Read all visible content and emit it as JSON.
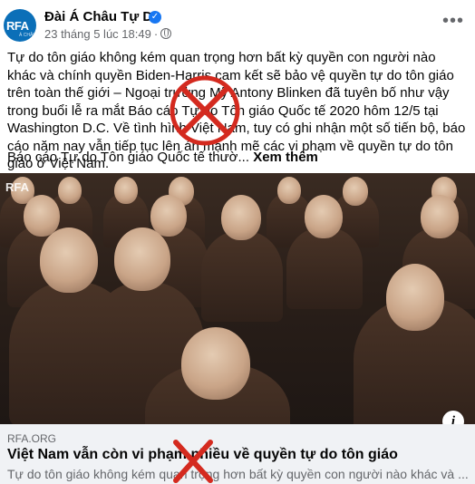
{
  "post": {
    "page_name": "Đài Á Châu Tự Do",
    "avatar_text": "RFA",
    "avatar_subtext": "Á CHÂU",
    "timestamp": "23 tháng 5 lúc 18:49",
    "separator": "·",
    "more_label": "•••",
    "body_text": "Tự do tôn giáo không kém quan trọng hơn bất kỳ quyền con người nào khác và chính quyền Biden-Harris cam kết sẽ bảo vệ quyền tự do tôn giáo trên toàn thế giới – Ngoại trưởng Mỹ Antony Blinken đã tuyên bố như vậy trong buổi lễ ra mắt Báo cáo Tự do Tôn giáo Quốc tế 2020 hôm 12/5 tại Washington D.C. Về tình hình Việt Nam, tuy có ghi nhận một số tiến bộ, báo cáo năm nay vẫn tiếp tục lên án mạnh mẽ các vi phạm về quyền tự do tôn giáo ở Việt Nam.",
    "caption": "Báo cáo Tự do Tôn giáo Quốc tế thườ...",
    "see_more": "Xem thêm"
  },
  "photo": {
    "watermark": "RFA",
    "alt": "photo-of-nuns"
  },
  "link_preview": {
    "domain": "RFA.ORG",
    "title": "Việt Nam vẫn còn vi phạm nhiều về quyền tự do tôn giáo",
    "description": "Tự do tôn giáo không kém quan trọng hơn bất kỳ quyền con người nào khác và ..."
  },
  "icons": {
    "verified": "verified-badge-icon",
    "globe": "globe-icon",
    "info": "info-icon"
  },
  "colors": {
    "facebook_blue": "#1877f2",
    "secondary_text": "#65676b",
    "link_box_bg": "#f0f2f5",
    "cross_mark": "#d42a1f"
  }
}
